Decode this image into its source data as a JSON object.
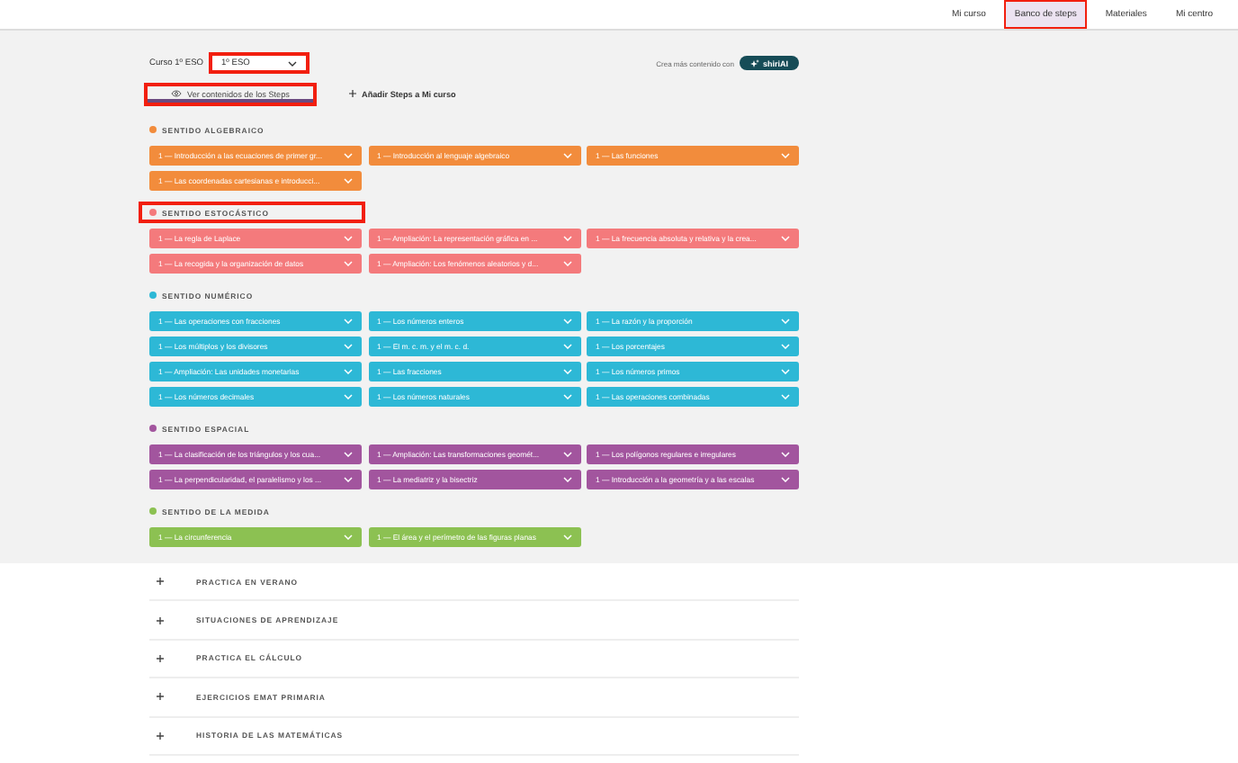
{
  "nav": [
    {
      "label": "Mi curso",
      "selected": false,
      "highlighted": false
    },
    {
      "label": "Banco de steps",
      "selected": true,
      "highlighted": true
    },
    {
      "label": "Materiales",
      "selected": false,
      "highlighted": false
    },
    {
      "label": "Mi centro",
      "selected": false,
      "highlighted": false
    }
  ],
  "course": {
    "label": "Curso 1º ESO",
    "value": "1º ESO",
    "highlighted": true
  },
  "promo": {
    "text": "Crea más contenido con",
    "button": "shiriAI"
  },
  "view_tab": {
    "label": "Ver contenidos de los Steps",
    "selected": true,
    "highlighted": true
  },
  "add_button": "Añadir Steps a Mi curso",
  "sections": [
    {
      "title": "SENTIDO ALGEBRAICO",
      "color": "#f28c3c",
      "highlighted": false,
      "steps": [
        "1 — Introducción a las ecuaciones de primer gr...",
        "1 — Introducción al lenguaje algebraico",
        "1 — Las funciones",
        "1 — Las coordenadas cartesianas e introducci..."
      ]
    },
    {
      "title": "SENTIDO ESTOCÁSTICO",
      "color": "#f47a7c",
      "highlighted": true,
      "steps": [
        "1 — La regla de Laplace",
        "1 — Ampliación: La representación gráfica en ...",
        "1 — La frecuencia absoluta y relativa y la crea...",
        "1 — La recogida y la organización de datos",
        "1 — Ampliación: Los fenómenos aleatorios y d..."
      ]
    },
    {
      "title": "SENTIDO NUMÉRICO",
      "color": "#2db8d6",
      "highlighted": false,
      "steps": [
        "1 — Las operaciones con fracciones",
        "1 — Los números enteros",
        "1 — La razón y la proporción",
        "1 — Los múltiplos y los divisores",
        "1 — El m. c. m. y el m. c. d.",
        "1 — Los porcentajes",
        "1 — Ampliación: Las unidades monetarias",
        "1 — Las fracciones",
        "1 — Los números primos",
        "1 — Los números decimales",
        "1 — Los números naturales",
        "1 — Las operaciones combinadas"
      ]
    },
    {
      "title": "SENTIDO ESPACIAL",
      "color": "#a2559e",
      "highlighted": false,
      "steps": [
        "1 — La clasificación de los triángulos y los cua...",
        "1 — Ampliación: Las transformaciones geomét...",
        "1 — Los polígonos regulares e irregulares",
        "1 — La perpendicularidad, el paralelismo y los ...",
        "1 — La mediatriz y la bisectriz",
        "1 — Introducción a la geometría y a las escalas"
      ]
    },
    {
      "title": "SENTIDO DE LA MEDIDA",
      "color": "#8cc152",
      "highlighted": false,
      "steps": [
        "1 — La circunferencia",
        "1 — El área y el perímetro de las figuras planas"
      ]
    }
  ],
  "accordion": [
    {
      "title": "PRACTICA EN VERANO",
      "expanded": false
    },
    {
      "title": "SITUACIONES DE APRENDIZAJE",
      "expanded": false
    },
    {
      "title": "PRACTICA EL CÁLCULO",
      "expanded": false
    },
    {
      "title": "EJERCICIOS EMAT PRIMARIA",
      "expanded": false
    },
    {
      "title": "HISTORIA DE LAS MATEMÁTICAS",
      "expanded": false
    }
  ]
}
